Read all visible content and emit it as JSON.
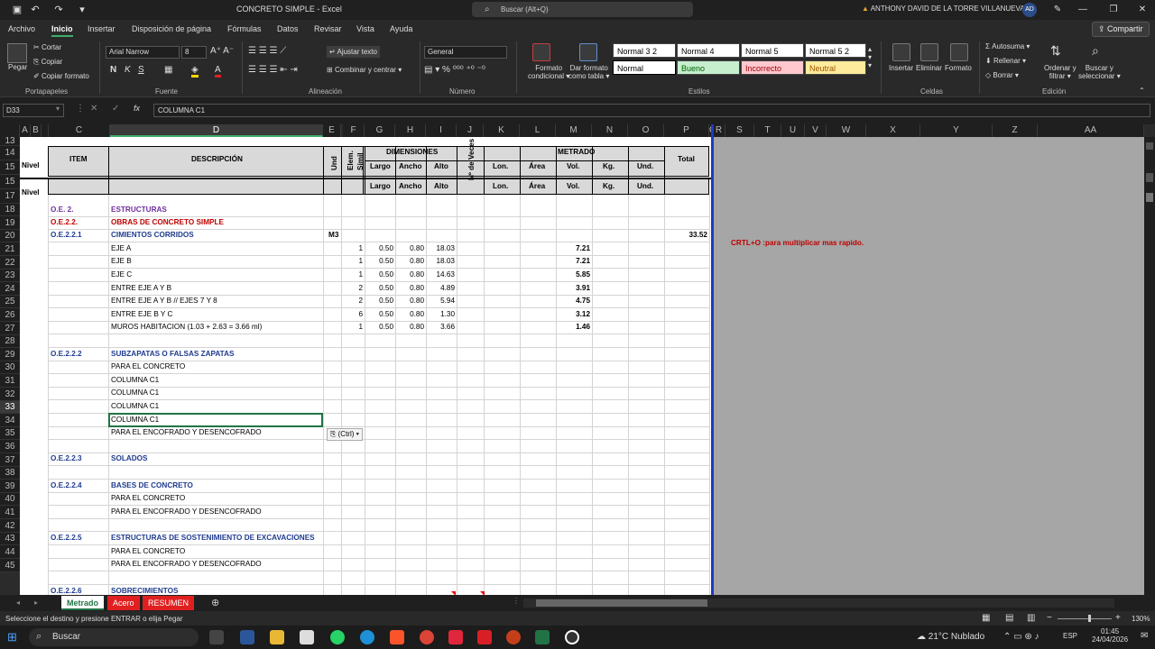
{
  "title": {
    "doc": "CONCRETO SIMPLE",
    "sep": " - ",
    "app": "Excel",
    "search_placeholder": "Buscar (Alt+Q)",
    "user": "ANTHONY DAVID DE LA TORRE VILLANUEVA",
    "initials": "AD"
  },
  "tabs": [
    "Archivo",
    "Inicio",
    "Insertar",
    "Disposición de página",
    "Fórmulas",
    "Datos",
    "Revisar",
    "Vista",
    "Ayuda"
  ],
  "share_label": "Compartir",
  "ribbon": {
    "paste": "Pegar",
    "cut": "Cortar",
    "copy": "Copiar",
    "format_painter": "Copiar formato",
    "font_name": "Arial Narrow",
    "font_size": "8",
    "wrap": "Ajustar texto",
    "merge": "Combinar y centrar",
    "number_format": "General",
    "cond_format_1": "Formato",
    "cond_format_2": "condicional",
    "table_format_1": "Dar formato",
    "table_format_2": "como tabla",
    "styles": [
      "Normal 3 2",
      "Normal 4",
      "Normal 5",
      "Normal 5 2",
      "Normal",
      "Bueno",
      "Incorrecto",
      "Neutral"
    ],
    "insert": "Insertar",
    "delete": "Eliminar",
    "format": "Formato",
    "autosum": "Autosuma",
    "fill": "Rellenar",
    "clear": "Borrar",
    "sort_1": "Ordenar y",
    "sort_2": "filtrar",
    "find_1": "Buscar y",
    "find_2": "seleccionar",
    "groups": [
      "Portapapeles",
      "Fuente",
      "Alineación",
      "Número",
      "Estilos",
      "Celdas",
      "Edición"
    ]
  },
  "formula": {
    "namebox": "D33",
    "fx": "fx",
    "content": "COLUMNA C1"
  },
  "columns": [
    "A",
    "B",
    "C",
    "D",
    "E",
    "F",
    "G",
    "H",
    "I",
    "J",
    "K",
    "L",
    "M",
    "N",
    "O",
    "P",
    "Q",
    "R",
    "S",
    "T",
    "U",
    "V",
    "W",
    "X",
    "Y",
    "Z",
    "AA",
    "A"
  ],
  "rows": [
    "13",
    "14",
    "15",
    "15",
    "17",
    "18",
    "19",
    "20",
    "21",
    "22",
    "23",
    "24",
    "25",
    "26",
    "27",
    "28",
    "29",
    "30",
    "31",
    "32",
    "33",
    "34",
    "35",
    "36",
    "37",
    "38",
    "39",
    "40",
    "41",
    "42",
    "43",
    "44",
    "45"
  ],
  "header": {
    "nivel": "Nivel",
    "item": "ITEM",
    "descripcion": "DESCRIPCIÓN",
    "und": "Und",
    "elem": "Elem.",
    "simil": "Simil",
    "dimensiones": "DIMENSIONES",
    "largo": "Largo",
    "ancho": "Ancho",
    "alto": "Alto",
    "veces": "Nº de Veces",
    "metrado": "METRADO",
    "lon": "Lon.",
    "area": "Área",
    "vol": "Vol.",
    "kg": "Kg.",
    "und2": "Und.",
    "total": "Total"
  },
  "sheet_rows": [
    {
      "item": "O.E. 2.",
      "desc": "ESTRUCTURAS",
      "style": "purple"
    },
    {
      "item": "O.E.2.2.",
      "desc": "OBRAS DE CONCRETO SIMPLE",
      "style": "red"
    },
    {
      "item": "O.E.2.2.1",
      "desc": "CIMIENTOS CORRIDOS",
      "und": "M3",
      "total": "33.52",
      "style": "item"
    },
    {
      "desc": "EJE A",
      "elem": "1",
      "largo": "0.50",
      "ancho": "0.80",
      "alto": "18.03",
      "vol": "7.21"
    },
    {
      "desc": "EJE B",
      "elem": "1",
      "largo": "0.50",
      "ancho": "0.80",
      "alto": "18.03",
      "vol": "7.21"
    },
    {
      "desc": "EJE C",
      "elem": "1",
      "largo": "0.50",
      "ancho": "0.80",
      "alto": "14.63",
      "vol": "5.85"
    },
    {
      "desc": "ENTRE EJE A Y B",
      "elem": "2",
      "largo": "0.50",
      "ancho": "0.80",
      "alto": "4.89",
      "vol": "3.91"
    },
    {
      "desc": "ENTRE EJE A Y B // EJES 7 Y 8",
      "elem": "2",
      "largo": "0.50",
      "ancho": "0.80",
      "alto": "5.94",
      "vol": "4.75"
    },
    {
      "desc": "ENTRE EJE B Y C",
      "elem": "6",
      "largo": "0.50",
      "ancho": "0.80",
      "alto": "1.30",
      "vol": "3.12"
    },
    {
      "desc": "MUROS HABITACION (1.03 + 2.63 = 3.66 ml)",
      "elem": "1",
      "largo": "0.50",
      "ancho": "0.80",
      "alto": "3.66",
      "vol": "1.46"
    },
    {},
    {
      "item": "O.E.2.2.2",
      "desc": "SUBZAPATAS O FALSAS ZAPATAS",
      "style": "item"
    },
    {
      "desc": "PARA EL CONCRETO"
    },
    {
      "desc": "COLUMNA C1"
    },
    {
      "desc": "COLUMNA C1"
    },
    {
      "desc": "COLUMNA C1"
    },
    {
      "desc": "COLUMNA C1"
    },
    {
      "desc": "PARA EL ENCOFRADO Y DESENCOFRADO"
    },
    {},
    {
      "item": "O.E.2.2.3",
      "desc": "SOLADOS",
      "style": "item"
    },
    {},
    {
      "item": "O.E.2.2.4",
      "desc": "BASES DE CONCRETO",
      "style": "item"
    },
    {
      "desc": "PARA EL CONCRETO"
    },
    {
      "desc": "PARA EL ENCOFRADO Y DESENCOFRADO"
    },
    {},
    {
      "item": "O.E.2.2.5",
      "desc": "ESTRUCTURAS DE SOSTENIMIENTO DE EXCAVACIONES",
      "style": "item"
    },
    {
      "desc": "PARA EL CONCRETO"
    },
    {
      "desc": "PARA EL ENCOFRADO Y DESENCOFRADO"
    },
    {},
    {
      "item": "O.E.2.2.6",
      "desc": "SOBRECIMIENTOS",
      "style": "item"
    }
  ],
  "note": "CRTL+O :para multiplicar mas rapido.",
  "paste_options": "(Ctrl)",
  "sheet_tabs": [
    "Metrado",
    "Acero",
    "RESUMEN"
  ],
  "status": {
    "message": "Seleccione el destino y presione ENTRAR o elija Pegar",
    "zoom": "130%"
  },
  "taskbar": {
    "search": "Buscar",
    "weather": "21°C  Nublado",
    "lang": "ESP",
    "time": "01:45",
    "date": "24/04/2026"
  }
}
